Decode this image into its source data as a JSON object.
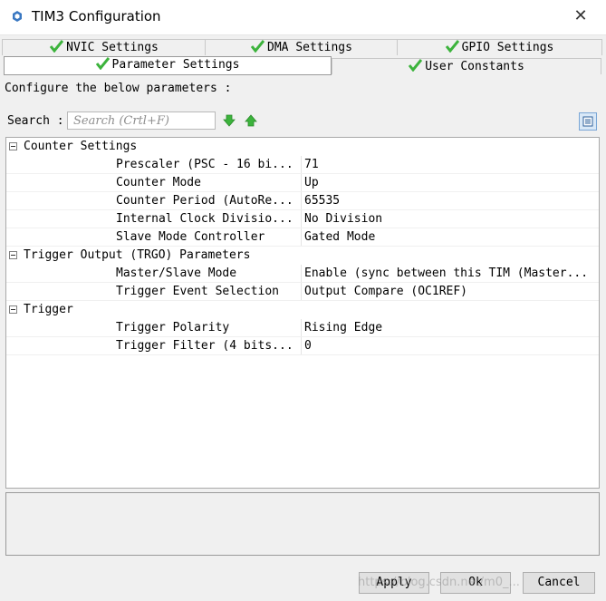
{
  "window": {
    "title": "TIM3 Configuration",
    "close": "✕"
  },
  "tabs": {
    "row1": [
      "NVIC Settings",
      "DMA Settings",
      "GPIO Settings"
    ],
    "row2": [
      "Parameter Settings",
      "User Constants"
    ],
    "active": "Parameter Settings",
    "check_color": "#3cb33c"
  },
  "intro": "Configure the below parameters :",
  "search": {
    "label": "Search :",
    "placeholder": "Search (Crtl+F)"
  },
  "groups": [
    {
      "label": "Counter Settings",
      "params": [
        {
          "name": "Prescaler (PSC - 16 bi...",
          "value": "71"
        },
        {
          "name": "Counter Mode",
          "value": "Up"
        },
        {
          "name": "Counter Period (AutoRe...",
          "value": "65535"
        },
        {
          "name": "Internal Clock Divisio...",
          "value": "No Division"
        },
        {
          "name": "Slave Mode Controller",
          "value": "Gated Mode"
        }
      ]
    },
    {
      "label": "Trigger Output (TRGO) Parameters",
      "params": [
        {
          "name": "Master/Slave Mode",
          "value": "Enable (sync between this TIM (Master..."
        },
        {
          "name": "Trigger Event Selection",
          "value": "Output Compare (OC1REF)"
        }
      ]
    },
    {
      "label": "Trigger",
      "params": [
        {
          "name": "Trigger Polarity",
          "value": "Rising Edge"
        },
        {
          "name": "Trigger Filter (4 bits...",
          "value": "0"
        }
      ]
    }
  ],
  "buttons": {
    "apply": "Apply",
    "ok": "Ok",
    "cancel": "Cancel"
  },
  "watermark": "https://blog.csdn.net/m0_..."
}
